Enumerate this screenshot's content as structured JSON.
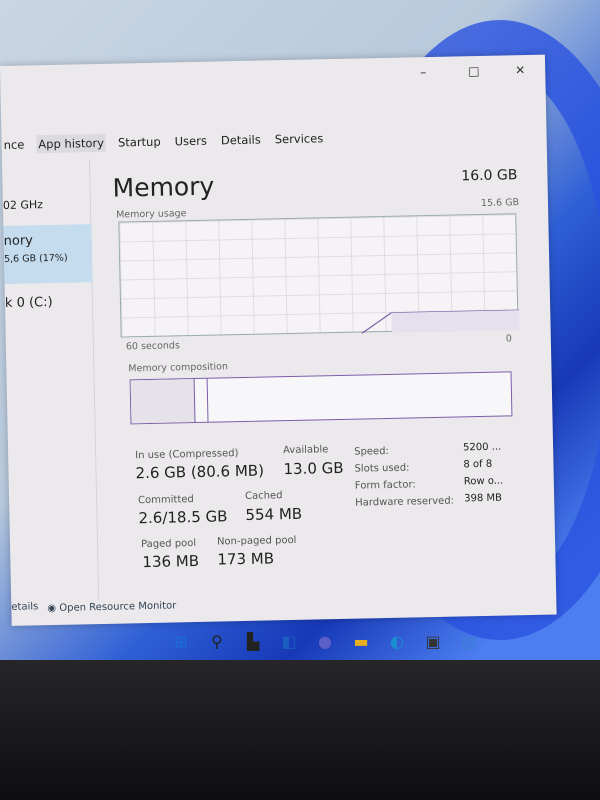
{
  "window": {
    "minimize": "–",
    "maximize": "□",
    "close": "✕"
  },
  "tabs": [
    "nce",
    "App history",
    "Startup",
    "Users",
    "Details",
    "Services"
  ],
  "sidebar": {
    "cpu_speed": "02 GHz",
    "memory_label": "nory",
    "memory_value": "5,6 GB (17%)",
    "disk_label": "k 0 (C:)"
  },
  "main": {
    "title": "Memory",
    "total": "16.0 GB",
    "usage_label": "Memory usage",
    "usage_max": "15.6 GB",
    "time_label": "60 seconds",
    "time_min": "0",
    "composition_label": "Memory composition",
    "in_use_label": "In use (Compressed)",
    "in_use": "2.6 GB (80.6 MB)",
    "available_label": "Available",
    "available": "13.0 GB",
    "committed_label": "Committed",
    "committed": "2.6/18.5 GB",
    "cached_label": "Cached",
    "cached": "554 MB",
    "paged_label": "Paged pool",
    "paged": "136 MB",
    "nonpaged_label": "Non-paged pool",
    "nonpaged": "173 MB",
    "specs": [
      {
        "label": "Speed:",
        "value": "5200 ..."
      },
      {
        "label": "Slots used:",
        "value": "8 of 8"
      },
      {
        "label": "Form factor:",
        "value": "Row o..."
      },
      {
        "label": "Hardware reserved:",
        "value": "398 MB"
      }
    ],
    "usage_percent": 17
  },
  "footer": {
    "details": "etails",
    "resource_monitor": "Open Resource Monitor"
  },
  "taskbar": [
    "start-icon",
    "search-icon",
    "task-view-icon",
    "widgets-icon",
    "chat-icon",
    "file-explorer-icon",
    "edge-icon",
    "store-icon",
    "task-manager-icon"
  ]
}
